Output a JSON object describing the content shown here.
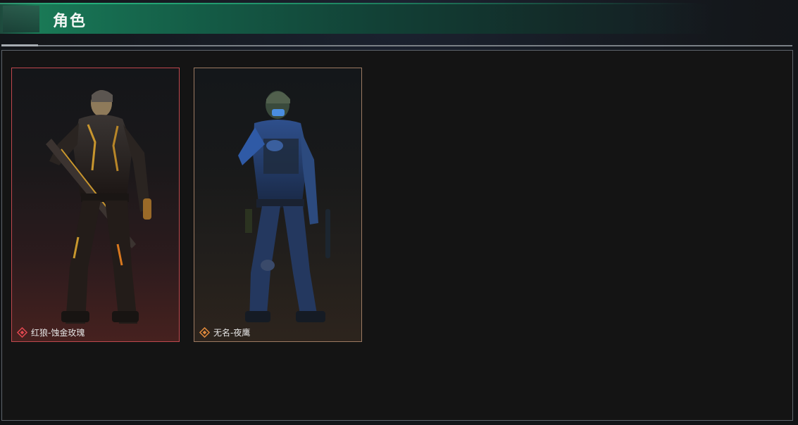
{
  "header": {
    "title": "角色"
  },
  "characters": [
    {
      "name": "红狼-蚀金玫瑰",
      "rarity_color": "#e0474f",
      "icon": "diamond-rarity-icon"
    },
    {
      "name": "无名-夜鹰",
      "rarity_color": "#e08a3c",
      "icon": "diamond-rarity-icon"
    }
  ]
}
